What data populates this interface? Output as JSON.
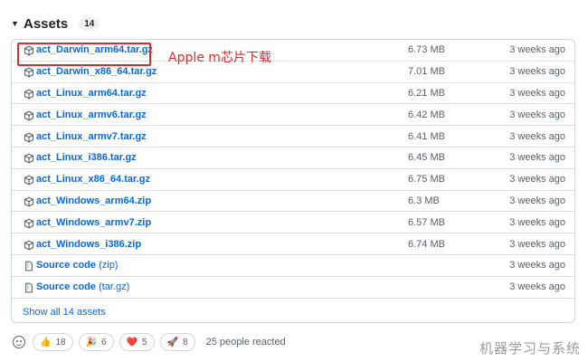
{
  "assets": {
    "title": "Assets",
    "count": "14",
    "rows": [
      {
        "name": "act_Darwin_arm64.tar.gz",
        "size": "6.73 MB",
        "time": "3 weeks ago"
      },
      {
        "name": "act_Darwin_x86_64.tar.gz",
        "size": "7.01 MB",
        "time": "3 weeks ago"
      },
      {
        "name": "act_Linux_arm64.tar.gz",
        "size": "6.21 MB",
        "time": "3 weeks ago"
      },
      {
        "name": "act_Linux_armv6.tar.gz",
        "size": "6.42 MB",
        "time": "3 weeks ago"
      },
      {
        "name": "act_Linux_armv7.tar.gz",
        "size": "6.41 MB",
        "time": "3 weeks ago"
      },
      {
        "name": "act_Linux_i386.tar.gz",
        "size": "6.45 MB",
        "time": "3 weeks ago"
      },
      {
        "name": "act_Linux_x86_64.tar.gz",
        "size": "6.75 MB",
        "time": "3 weeks ago"
      },
      {
        "name": "act_Windows_arm64.zip",
        "size": "6.3 MB",
        "time": "3 weeks ago"
      },
      {
        "name": "act_Windows_armv7.zip",
        "size": "6.57 MB",
        "time": "3 weeks ago"
      },
      {
        "name": "act_Windows_i386.zip",
        "size": "6.74 MB",
        "time": "3 weeks ago"
      },
      {
        "name": "Source code",
        "sub": "(zip)",
        "size": "",
        "time": "3 weeks ago"
      },
      {
        "name": "Source code",
        "sub": "(tar.gz)",
        "size": "",
        "time": "3 weeks ago"
      }
    ],
    "show_all": "Show all 14 assets"
  },
  "annotation": "Apple m芯片下载",
  "reactions": {
    "items": [
      {
        "emoji": "👍",
        "count": "18"
      },
      {
        "emoji": "🎉",
        "count": "6"
      },
      {
        "emoji": "❤️",
        "count": "5"
      },
      {
        "emoji": "🚀",
        "count": "8"
      }
    ],
    "summary": "25 people reacted"
  },
  "watermark": "机器学习与系统",
  "colors": {
    "link": "#0969da",
    "muted": "#57606a",
    "annotation": "#d32f2f",
    "border": "#d0d7de"
  },
  "icons": {
    "package": "package-icon",
    "file_zip": "file-zip-icon",
    "caret": "triangle-down-icon",
    "smiley": "smiley-icon"
  }
}
